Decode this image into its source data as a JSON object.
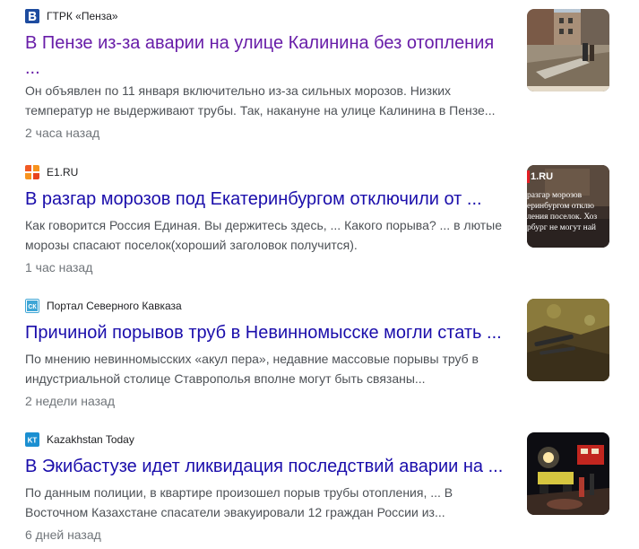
{
  "news": [
    {
      "source": "ГТРК «Пенза»",
      "icon": "letter-b-logo-icon",
      "title_line1": "В Пензе из-за аварии на улице Калинина без отопления",
      "title_line2": "...",
      "snippet_line1": "Он объявлен по 11 января включительно из-за сильных морозов. Низких",
      "snippet_line2": "температур не выдерживают трубы. Так, накануне на улице Калинина в Пензе...",
      "time": "2 часа назад",
      "thumb": "winter-street-photo"
    },
    {
      "source": "E1.RU",
      "icon": "orange-squares-logo-icon",
      "title_line1": "В разгар морозов под Екатеринбургом отключили от ...",
      "snippet_line1": "Как говорится Россия Единая. Вы держитесь здесь, ... Какого порыва? ... в лютые",
      "snippet_line2": "морозы спасают поселок(хороший заголовок получится).",
      "time": "1 час назад",
      "thumb": "news-graphic-photo",
      "thumb_text": {
        "brand": "1.RU",
        "lines": [
          "разгар морозов",
          "еринбургом отклю",
          "ления поселок. Хоз",
          "рбург не могут най"
        ]
      }
    },
    {
      "source": "Портал Северного Кавказа",
      "icon": "ck-logo-icon",
      "title_line1": "Причиной порывов труб в Невинномысске могли стать ...",
      "snippet_line1": "По мнению невинномысских «акул пера», недавние массовые порывы труб в",
      "snippet_line2": "индустриальной столице Ставрополья вполне могут быть связаны...",
      "time": "2 недели назад",
      "thumb": "pipe-excavation-photo"
    },
    {
      "source": "Kazakhstan Today",
      "icon": "kt-logo-icon",
      "title_line1": "В Экибастузе идет ликвидация последствий аварии на ...",
      "snippet_line1": "По данным полиции, в квартире произошел порыв трубы отопления, ... В",
      "snippet_line2": "Восточном Казахстане спасатели эвакуировали 12 граждан России из...",
      "time": "6 дней назад",
      "thumb": "night-repair-photo"
    }
  ],
  "colors": {
    "link": "#1a0dab",
    "visited_link": "#681da8",
    "snippet": "#4d5156",
    "time": "#70757a"
  }
}
